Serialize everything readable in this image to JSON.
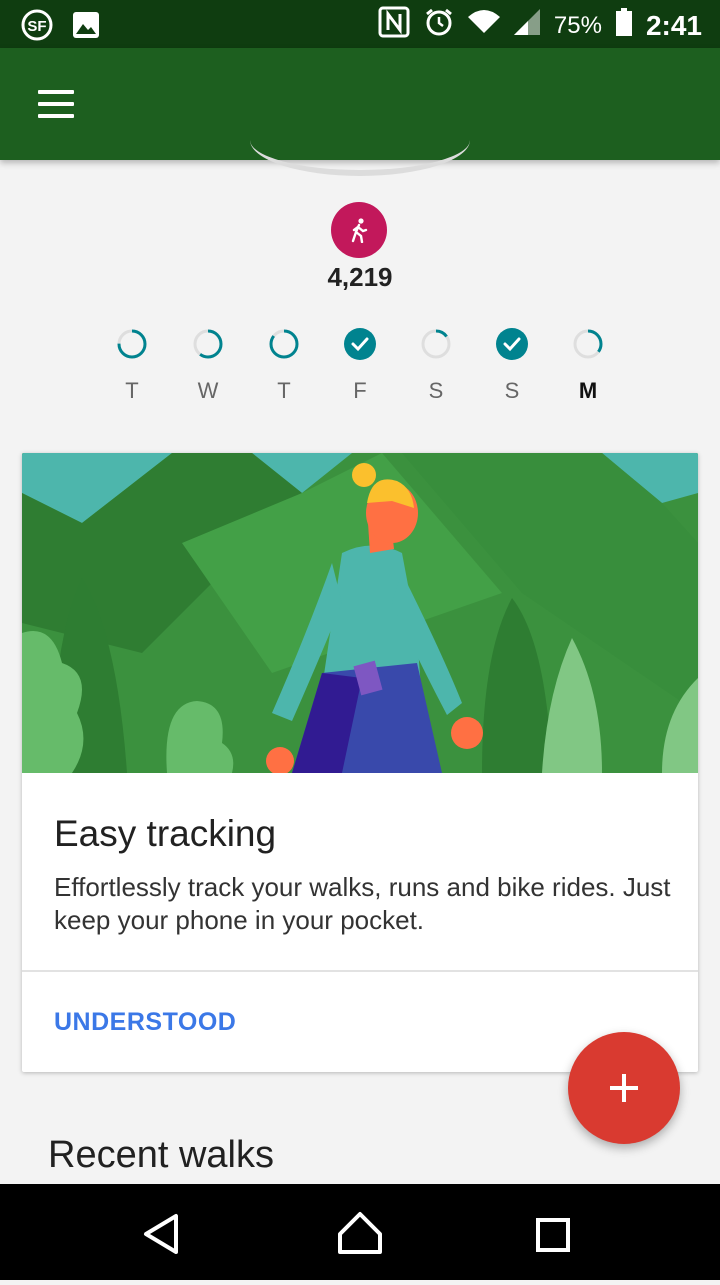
{
  "status_bar": {
    "left_icons": [
      "sf-icon",
      "image-icon"
    ],
    "right_icons": [
      "nfc-icon",
      "alarm-icon",
      "wifi-icon",
      "signal-icon"
    ],
    "battery": "75%",
    "time": "2:41"
  },
  "app_bar": {
    "menu_icon": "menu-icon"
  },
  "summary": {
    "activity_icon": "walking-icon",
    "activity_color": "#c2185b",
    "steps": "4,219"
  },
  "week": [
    {
      "label": "T",
      "progress": 0.75,
      "complete": false,
      "current": false
    },
    {
      "label": "W",
      "progress": 0.6,
      "complete": false,
      "current": false
    },
    {
      "label": "T",
      "progress": 0.85,
      "complete": false,
      "current": false
    },
    {
      "label": "F",
      "progress": 1.0,
      "complete": true,
      "current": false
    },
    {
      "label": "S",
      "progress": 0.15,
      "complete": false,
      "current": false
    },
    {
      "label": "S",
      "progress": 1.0,
      "complete": true,
      "current": false
    },
    {
      "label": "M",
      "progress": 0.35,
      "complete": false,
      "current": true
    }
  ],
  "card": {
    "title": "Easy tracking",
    "body": "Effortlessly track your walks, runs and bike rides. Just keep your phone in your pocket.",
    "action": "UNDERSTOOD"
  },
  "fab": {
    "icon": "plus-icon",
    "color": "#d93a30"
  },
  "section": {
    "title": "Recent walks"
  },
  "colors": {
    "app_bar": "#1d5f1f",
    "status_bar": "#0f3d10",
    "accent_teal": "#00838f",
    "link": "#3b78e7"
  },
  "nav": {
    "icons": [
      "back-icon",
      "home-icon",
      "recents-icon"
    ]
  }
}
